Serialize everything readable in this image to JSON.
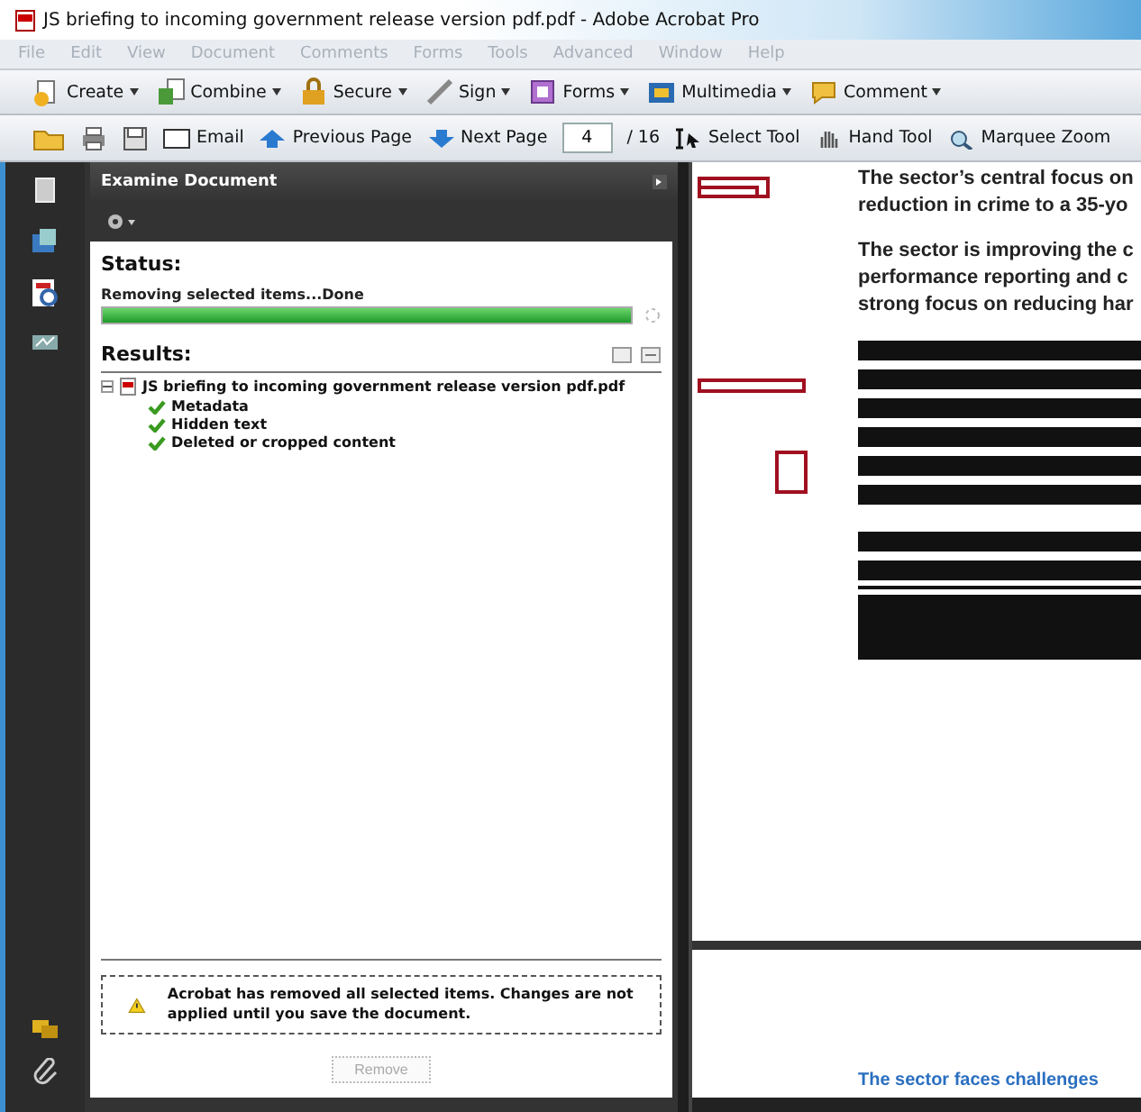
{
  "window": {
    "title": "JS briefing to incoming government release version pdf.pdf - Adobe Acrobat Pro"
  },
  "menu": [
    "File",
    "Edit",
    "View",
    "Document",
    "Comments",
    "Forms",
    "Tools",
    "Advanced",
    "Window",
    "Help"
  ],
  "task_toolbar": [
    {
      "label": "Create"
    },
    {
      "label": "Combine"
    },
    {
      "label": "Secure"
    },
    {
      "label": "Sign"
    },
    {
      "label": "Forms"
    },
    {
      "label": "Multimedia"
    },
    {
      "label": "Comment"
    }
  ],
  "nav_toolbar": {
    "email": "Email",
    "previous": "Previous Page",
    "next": "Next Page",
    "page": "4",
    "page_count": "/ 16",
    "select_tool": "Select Tool",
    "hand_tool": "Hand Tool",
    "marquee_zoom": "Marquee Zoom"
  },
  "panel": {
    "title": "Examine Document",
    "status_heading": "Status:",
    "status_text": "Removing selected items...Done",
    "progress": {
      "level": 1.0
    },
    "results_heading": "Results:",
    "results": [
      {
        "label": "JS briefing to incoming government release version pdf.pdf",
        "expanded": true,
        "children": [
          {
            "label": "Metadata",
            "checked": true
          },
          {
            "label": "Hidden text",
            "checked": true
          },
          {
            "label": "Deleted or cropped content",
            "checked": true
          }
        ]
      }
    ],
    "notice": "Acrobat has removed all selected items. Changes are not applied until you save the document.",
    "button": {
      "label": "Remove",
      "disabled": true
    }
  },
  "document": {
    "paragraphs": [
      [
        "The sector’s central focus on",
        "reduction in crime to a 35-yo"
      ],
      [
        "The sector is improving the c",
        "performance reporting and c",
        "strong focus on reducing har"
      ]
    ],
    "next_page_heading": "The sector faces challenges"
  }
}
